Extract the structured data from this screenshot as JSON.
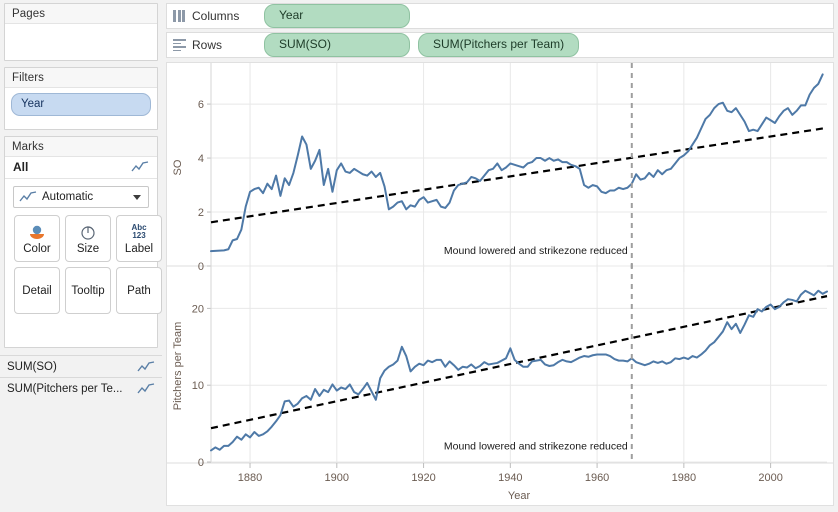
{
  "sidebar": {
    "pages": {
      "title": "Pages",
      "items": []
    },
    "filters": {
      "title": "Filters",
      "items": [
        {
          "label": "Year"
        }
      ]
    },
    "marks": {
      "title": "Marks",
      "all_label": "All",
      "mark_type": "Automatic",
      "buttons": [
        {
          "label": "Color",
          "icon": "color-palette-icon"
        },
        {
          "label": "Size",
          "icon": "size-icon"
        },
        {
          "label": "Label",
          "icon": "abc123-label-icon"
        },
        {
          "label": "Detail",
          "icon": ""
        },
        {
          "label": "Tooltip",
          "icon": ""
        },
        {
          "label": "Path",
          "icon": ""
        }
      ]
    },
    "measure_cards": [
      {
        "label": "SUM(SO)",
        "icon": "line-chart-icon"
      },
      {
        "label": "SUM(Pitchers per Te...",
        "icon": "line-chart-icon"
      }
    ]
  },
  "shelves": {
    "columns": {
      "label": "Columns",
      "pills": [
        "Year"
      ]
    },
    "rows": {
      "label": "Rows",
      "pills": [
        "SUM(SO)",
        "SUM(Pitchers per Team)"
      ]
    }
  },
  "colors": {
    "line": "#4E79A7",
    "trend": "#000000",
    "reference_line": "#9e9e9e",
    "pill_green": "#B2DCC1",
    "pill_blue": "#C7DAF1",
    "axis_text": "#6B5C52",
    "grid": "#E8E8E8"
  },
  "chart_data": [
    {
      "type": "line",
      "title": "",
      "xlabel": "Year",
      "ylabel": "SO",
      "xlim": [
        1871,
        2013
      ],
      "ylim": [
        0,
        7.3
      ],
      "yticks": [
        0,
        2,
        4,
        6
      ],
      "xticks": [
        1880,
        1900,
        1920,
        1940,
        1960,
        1980,
        2000
      ],
      "grid": true,
      "legend": "none",
      "annotations": [
        {
          "text": "Mound lowered and strikezone reduced",
          "x": 1968,
          "y": 0.45,
          "anchor": "end"
        }
      ],
      "reference_lines": [
        {
          "orientation": "vertical",
          "x": 1968,
          "style": "dashed",
          "color": "#9e9e9e"
        }
      ],
      "trend_line": {
        "style": "dashed",
        "color": "#000000",
        "x": [
          1871,
          2013
        ],
        "y": [
          1.62,
          5.12
        ]
      },
      "x": [
        1871,
        1872,
        1873,
        1874,
        1875,
        1876,
        1877,
        1878,
        1879,
        1880,
        1881,
        1882,
        1883,
        1884,
        1885,
        1886,
        1887,
        1888,
        1889,
        1890,
        1891,
        1892,
        1893,
        1894,
        1895,
        1896,
        1897,
        1898,
        1899,
        1900,
        1901,
        1902,
        1903,
        1904,
        1905,
        1906,
        1907,
        1908,
        1909,
        1910,
        1911,
        1912,
        1913,
        1914,
        1915,
        1916,
        1917,
        1918,
        1919,
        1920,
        1921,
        1922,
        1923,
        1924,
        1925,
        1926,
        1927,
        1928,
        1929,
        1930,
        1931,
        1932,
        1933,
        1934,
        1935,
        1936,
        1937,
        1938,
        1939,
        1940,
        1941,
        1942,
        1943,
        1944,
        1945,
        1946,
        1947,
        1948,
        1949,
        1950,
        1951,
        1952,
        1953,
        1954,
        1955,
        1956,
        1957,
        1958,
        1959,
        1960,
        1961,
        1962,
        1963,
        1964,
        1965,
        1966,
        1967,
        1968,
        1969,
        1970,
        1971,
        1972,
        1973,
        1974,
        1975,
        1976,
        1977,
        1978,
        1979,
        1980,
        1981,
        1982,
        1983,
        1984,
        1985,
        1986,
        1987,
        1988,
        1989,
        1990,
        1991,
        1992,
        1993,
        1994,
        1995,
        1996,
        1997,
        1998,
        1999,
        2000,
        2001,
        2002,
        2003,
        2004,
        2005,
        2006,
        2007,
        2008,
        2009,
        2010,
        2011,
        2012,
        2013
      ],
      "y": [
        0.55,
        0.56,
        0.57,
        0.58,
        0.62,
        0.95,
        1.0,
        1.35,
        2.2,
        2.75,
        2.85,
        2.9,
        2.7,
        3.05,
        2.85,
        3.35,
        2.6,
        3.25,
        3.0,
        3.45,
        4.1,
        4.8,
        4.5,
        3.6,
        3.9,
        4.3,
        3.0,
        3.6,
        2.75,
        3.55,
        3.8,
        3.5,
        3.45,
        3.6,
        3.5,
        3.4,
        3.35,
        3.5,
        3.3,
        3.45,
        2.95,
        2.1,
        2.2,
        2.35,
        2.4,
        2.1,
        2.25,
        2.2,
        2.45,
        2.55,
        2.35,
        2.4,
        2.45,
        2.2,
        2.15,
        2.35,
        2.8,
        3.0,
        3.05,
        3.1,
        3.3,
        3.25,
        3.15,
        3.35,
        3.55,
        3.6,
        3.8,
        3.55,
        3.65,
        3.8,
        3.75,
        3.7,
        3.65,
        3.8,
        3.85,
        4.0,
        4.0,
        3.9,
        4.0,
        3.9,
        3.95,
        3.85,
        3.85,
        3.75,
        3.7,
        3.6,
        3.0,
        2.9,
        3.0,
        2.95,
        2.75,
        2.7,
        2.8,
        2.8,
        2.9,
        2.85,
        2.9,
        3.05,
        3.4,
        3.2,
        3.25,
        3.45,
        3.3,
        3.55,
        3.4,
        3.55,
        3.6,
        3.8,
        4.0,
        4.1,
        4.25,
        4.5,
        4.75,
        5.1,
        5.45,
        5.6,
        5.85,
        6.0,
        6.05,
        5.75,
        5.7,
        5.85,
        5.6,
        5.35,
        5.0,
        5.05,
        5.0,
        5.25,
        5.5,
        5.4,
        5.3,
        5.55,
        5.75,
        5.85,
        5.6,
        5.75,
        5.95,
        5.95,
        6.35,
        6.6,
        6.75,
        7.1
      ]
    },
    {
      "type": "line",
      "title": "",
      "xlabel": "Year",
      "ylabel": "Pitchers per Team",
      "xlim": [
        1871,
        2013
      ],
      "ylim": [
        0,
        25
      ],
      "yticks": [
        0,
        10,
        20
      ],
      "xticks": [
        1880,
        1900,
        1920,
        1940,
        1960,
        1980,
        2000
      ],
      "grid": true,
      "legend": "none",
      "annotations": [
        {
          "text": "Mound lowered and strikezone reduced",
          "x": 1968,
          "y": 1.6,
          "anchor": "end"
        }
      ],
      "reference_lines": [
        {
          "orientation": "vertical",
          "x": 1968,
          "style": "dashed",
          "color": "#9e9e9e"
        }
      ],
      "trend_line": {
        "style": "dashed",
        "color": "#000000",
        "x": [
          1871,
          2013
        ],
        "y": [
          4.4,
          21.6
        ]
      },
      "x": [
        1871,
        1872,
        1873,
        1874,
        1875,
        1876,
        1877,
        1878,
        1879,
        1880,
        1881,
        1882,
        1883,
        1884,
        1885,
        1886,
        1887,
        1888,
        1889,
        1890,
        1891,
        1892,
        1893,
        1894,
        1895,
        1896,
        1897,
        1898,
        1899,
        1900,
        1901,
        1902,
        1903,
        1904,
        1905,
        1906,
        1907,
        1908,
        1909,
        1910,
        1911,
        1912,
        1913,
        1914,
        1915,
        1916,
        1917,
        1918,
        1919,
        1920,
        1921,
        1922,
        1923,
        1924,
        1925,
        1926,
        1927,
        1928,
        1929,
        1930,
        1931,
        1932,
        1933,
        1934,
        1935,
        1936,
        1937,
        1938,
        1939,
        1940,
        1941,
        1942,
        1943,
        1944,
        1945,
        1946,
        1947,
        1948,
        1949,
        1950,
        1951,
        1952,
        1953,
        1954,
        1955,
        1956,
        1957,
        1958,
        1959,
        1960,
        1961,
        1962,
        1963,
        1964,
        1965,
        1966,
        1967,
        1968,
        1969,
        1970,
        1971,
        1972,
        1973,
        1974,
        1975,
        1976,
        1977,
        1978,
        1979,
        1980,
        1981,
        1982,
        1983,
        1984,
        1985,
        1986,
        1987,
        1988,
        1989,
        1990,
        1991,
        1992,
        1993,
        1994,
        1995,
        1996,
        1997,
        1998,
        1999,
        2000,
        2001,
        2002,
        2003,
        2004,
        2005,
        2006,
        2007,
        2008,
        2009,
        2010,
        2011,
        2012,
        2013
      ],
      "y": [
        1.5,
        1.9,
        1.6,
        2.1,
        2.1,
        2.6,
        3.3,
        2.9,
        3.6,
        3.2,
        3.9,
        3.4,
        3.6,
        4.0,
        4.6,
        5.3,
        6.1,
        7.9,
        8.0,
        7.2,
        7.6,
        8.3,
        8.6,
        8.1,
        9.5,
        8.6,
        9.4,
        9.1,
        10.1,
        9.3,
        9.7,
        9.5,
        10.1,
        9.1,
        8.8,
        9.5,
        10.3,
        9.2,
        8.1,
        10.9,
        11.9,
        12.4,
        12.7,
        13.2,
        15.0,
        13.8,
        11.8,
        12.4,
        12.8,
        12.6,
        13.2,
        13.0,
        13.3,
        13.3,
        12.4,
        13.1,
        12.6,
        12.0,
        12.4,
        12.3,
        12.7,
        12.2,
        12.5,
        13.0,
        12.7,
        12.8,
        12.9,
        13.2,
        13.5,
        14.8,
        13.3,
        12.8,
        12.4,
        12.4,
        13.1,
        13.2,
        13.3,
        12.7,
        12.5,
        12.6,
        13.0,
        13.3,
        13.1,
        13.0,
        13.3,
        13.6,
        13.8,
        13.7,
        13.9,
        14.0,
        14.0,
        14.0,
        13.8,
        13.4,
        13.2,
        13.2,
        13.1,
        13.5,
        13.0,
        12.8,
        12.6,
        12.8,
        13.1,
        12.9,
        13.1,
        12.8,
        13.0,
        13.5,
        13.4,
        13.6,
        13.4,
        13.8,
        13.6,
        14.0,
        14.5,
        15.2,
        15.6,
        16.3,
        17.0,
        18.2,
        17.3,
        18.0,
        16.8,
        17.9,
        19.1,
        18.9,
        19.9,
        19.6,
        20.2,
        20.5,
        19.9,
        20.2,
        20.8,
        21.2,
        21.1,
        20.9,
        21.8,
        22.3,
        22.0,
        21.7,
        22.3,
        21.9,
        22.2
      ]
    }
  ]
}
